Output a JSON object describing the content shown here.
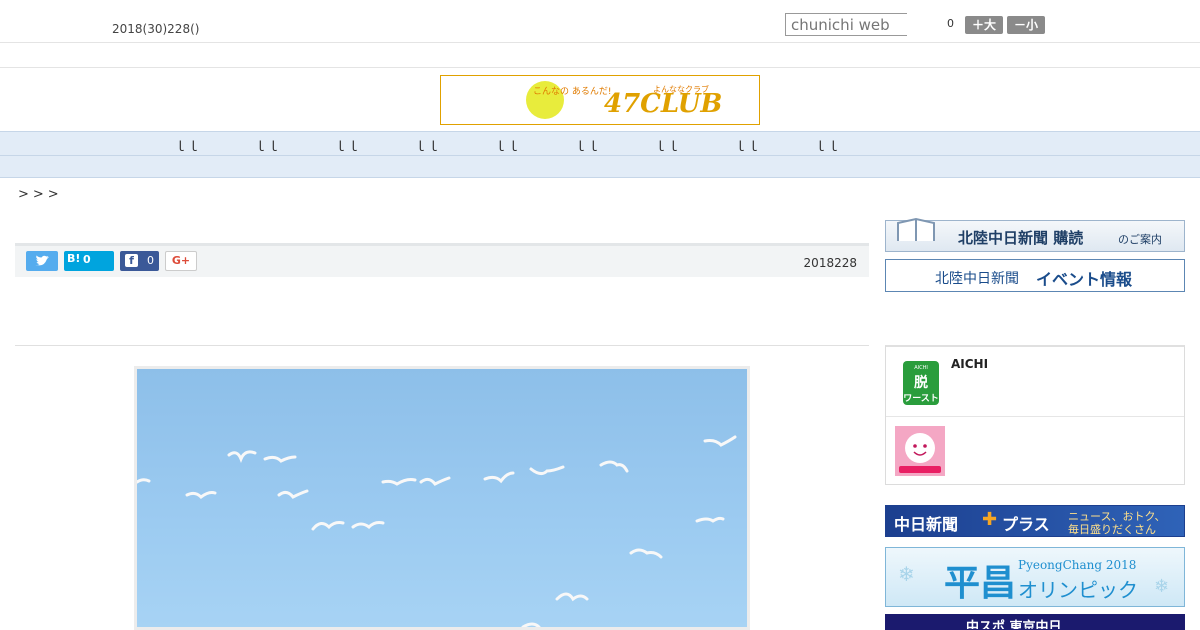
{
  "header": {
    "date_text": "2018(30)228()",
    "search_placeholder": "chunichi web",
    "count": "0",
    "font_larger_label": "＋大",
    "font_smaller_label": "－小"
  },
  "logo": {
    "text_left": "こんなの あるんだ!",
    "text_brand": "47CLUB",
    "text_small": "よんななクラブ"
  },
  "nav": {
    "items": [
      "ｌｌ",
      "ｌｌ",
      "ｌｌ",
      "ｌｌ",
      "ｌｌ",
      "ｌｌ",
      "ｌｌ",
      "ｌｌ",
      "ｌｌ"
    ]
  },
  "breadcrumb": ">>>",
  "share": {
    "hatena_count": "0",
    "facebook_count": "0",
    "gplus_label": "G+"
  },
  "article": {
    "date": "2018228"
  },
  "sidebar": {
    "subscribe_banner": {
      "main": "北陸中日新聞 購読",
      "sub": "のご案内"
    },
    "event_banner": {
      "prefix": "北陸中日新聞",
      "main": "イベント情報"
    },
    "widget": {
      "aichi_label": "AICHI",
      "aichi_badge_top": "AICHI",
      "aichi_badge_main": "脱",
      "aichi_badge_sub": "ワースト"
    },
    "plus_banner": {
      "name": "中日新聞",
      "plus": "プラス",
      "tagline1": "ニュース、おトク、",
      "tagline2": "毎日盛りだくさん"
    },
    "olympic_banner": {
      "kanji": "平昌",
      "roman": "PyeongChang 2018",
      "kana": "オリンピック"
    },
    "chuspo_banner": {
      "text": "中スポ 東京中日"
    }
  },
  "colors": {
    "nav_bg": "#e2ecf7",
    "twitter": "#55acee",
    "hatena": "#00a4de",
    "facebook": "#3b5998",
    "sky": "#9ccbf1",
    "logo_border": "#e0a100"
  }
}
